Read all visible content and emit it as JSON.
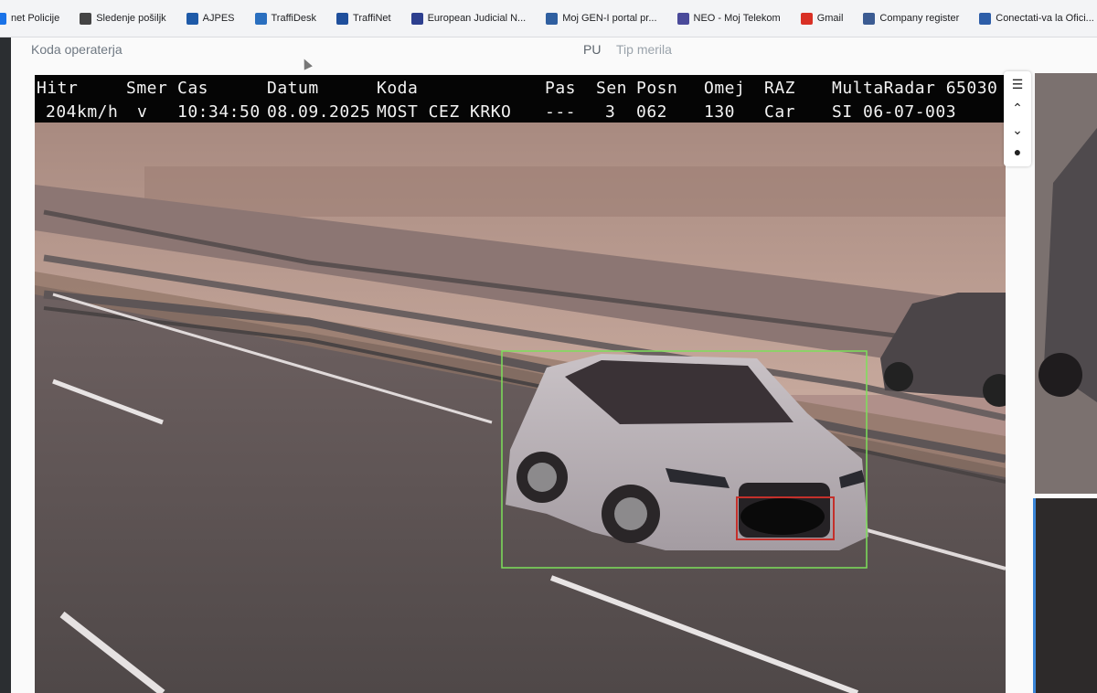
{
  "bookmarks": [
    {
      "label": "net Policije",
      "icon": "police-icon",
      "color": "#1a73e8"
    },
    {
      "label": "Sledenje pošiljk",
      "icon": "globe-icon",
      "color": "#444444"
    },
    {
      "label": "AJPES",
      "icon": "ajpes-icon",
      "color": "#1e5aa8"
    },
    {
      "label": "TraffiDesk",
      "icon": "traffidesk-icon",
      "color": "#2a6fbf"
    },
    {
      "label": "TraffiNet",
      "icon": "traffinet-icon",
      "color": "#1f4f9c"
    },
    {
      "label": "European Judicial N...",
      "icon": "ejn-icon",
      "color": "#2d3f8f"
    },
    {
      "label": "Moj GEN-I portal pr...",
      "icon": "geni-icon",
      "color": "#2f5fa0"
    },
    {
      "label": "NEO - Moj Telekom",
      "icon": "neo-icon",
      "color": "#4a4a9a"
    },
    {
      "label": "Gmail",
      "icon": "gmail-icon",
      "color": "#d93025"
    },
    {
      "label": "Company register",
      "icon": "register-icon",
      "color": "#3b5b92"
    },
    {
      "label": "Conectati-va la Ofici...",
      "icon": "office-icon",
      "color": "#2d5ea8"
    }
  ],
  "filters": {
    "operator_code": "Koda operaterja",
    "pu": "PU",
    "meter_type": "Tip merila"
  },
  "overlay": {
    "h_speed": "Hitr",
    "h_direction": "Smer",
    "h_time": "Cas",
    "h_date": "Datum",
    "h_code": "Koda",
    "h_lane": "Pas",
    "h_sensor": "Sen",
    "h_position": "Posn",
    "h_limit": "Omej",
    "h_class": "RAZ",
    "device": "MultaRadar 65030",
    "speed": "204km/h",
    "direction": "v",
    "time": "10:34:50",
    "date": "08.09.2025",
    "location": "MOST CEZ KRKO",
    "lane": "---",
    "sensor": "3",
    "position": "062",
    "limit": "130",
    "vehicle_class": "Car",
    "serial": "SI 06-07-003"
  },
  "colors": {
    "detection_box": "#7de05a",
    "plate_box": "#c4302b",
    "overlay_bg": "#050505",
    "scene_tint": "#b0908a"
  }
}
